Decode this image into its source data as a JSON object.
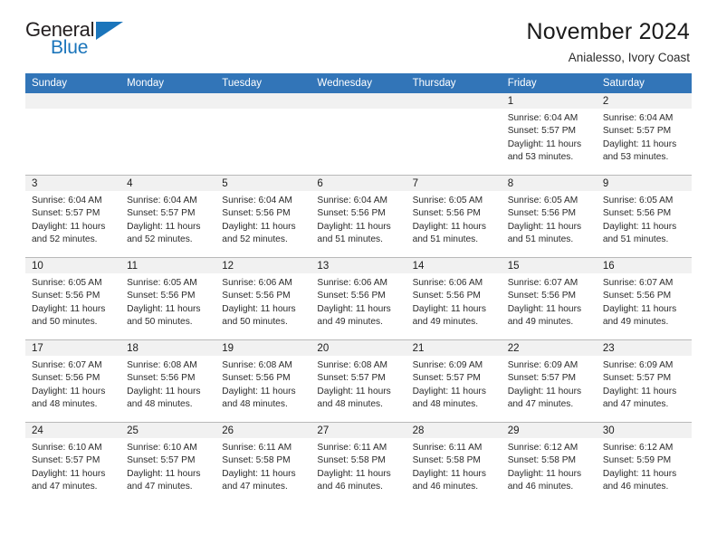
{
  "brand": {
    "name_top": "General",
    "name_bottom": "Blue",
    "accent_color": "#1b75bb",
    "logo_icon": "triangle-icon"
  },
  "header": {
    "title": "November 2024",
    "location": "Anialesso, Ivory Coast"
  },
  "calendar": {
    "header_bg": "#3275b8",
    "daynum_bg": "#f1f1f1",
    "weekday_headers": [
      "Sunday",
      "Monday",
      "Tuesday",
      "Wednesday",
      "Thursday",
      "Friday",
      "Saturday"
    ],
    "weeks": [
      [
        {
          "day": "",
          "empty": true
        },
        {
          "day": "",
          "empty": true
        },
        {
          "day": "",
          "empty": true
        },
        {
          "day": "",
          "empty": true
        },
        {
          "day": "",
          "empty": true
        },
        {
          "day": "1",
          "sunrise": "Sunrise: 6:04 AM",
          "sunset": "Sunset: 5:57 PM",
          "daylight": "Daylight: 11 hours and 53 minutes."
        },
        {
          "day": "2",
          "sunrise": "Sunrise: 6:04 AM",
          "sunset": "Sunset: 5:57 PM",
          "daylight": "Daylight: 11 hours and 53 minutes."
        }
      ],
      [
        {
          "day": "3",
          "sunrise": "Sunrise: 6:04 AM",
          "sunset": "Sunset: 5:57 PM",
          "daylight": "Daylight: 11 hours and 52 minutes."
        },
        {
          "day": "4",
          "sunrise": "Sunrise: 6:04 AM",
          "sunset": "Sunset: 5:57 PM",
          "daylight": "Daylight: 11 hours and 52 minutes."
        },
        {
          "day": "5",
          "sunrise": "Sunrise: 6:04 AM",
          "sunset": "Sunset: 5:56 PM",
          "daylight": "Daylight: 11 hours and 52 minutes."
        },
        {
          "day": "6",
          "sunrise": "Sunrise: 6:04 AM",
          "sunset": "Sunset: 5:56 PM",
          "daylight": "Daylight: 11 hours and 51 minutes."
        },
        {
          "day": "7",
          "sunrise": "Sunrise: 6:05 AM",
          "sunset": "Sunset: 5:56 PM",
          "daylight": "Daylight: 11 hours and 51 minutes."
        },
        {
          "day": "8",
          "sunrise": "Sunrise: 6:05 AM",
          "sunset": "Sunset: 5:56 PM",
          "daylight": "Daylight: 11 hours and 51 minutes."
        },
        {
          "day": "9",
          "sunrise": "Sunrise: 6:05 AM",
          "sunset": "Sunset: 5:56 PM",
          "daylight": "Daylight: 11 hours and 51 minutes."
        }
      ],
      [
        {
          "day": "10",
          "sunrise": "Sunrise: 6:05 AM",
          "sunset": "Sunset: 5:56 PM",
          "daylight": "Daylight: 11 hours and 50 minutes."
        },
        {
          "day": "11",
          "sunrise": "Sunrise: 6:05 AM",
          "sunset": "Sunset: 5:56 PM",
          "daylight": "Daylight: 11 hours and 50 minutes."
        },
        {
          "day": "12",
          "sunrise": "Sunrise: 6:06 AM",
          "sunset": "Sunset: 5:56 PM",
          "daylight": "Daylight: 11 hours and 50 minutes."
        },
        {
          "day": "13",
          "sunrise": "Sunrise: 6:06 AM",
          "sunset": "Sunset: 5:56 PM",
          "daylight": "Daylight: 11 hours and 49 minutes."
        },
        {
          "day": "14",
          "sunrise": "Sunrise: 6:06 AM",
          "sunset": "Sunset: 5:56 PM",
          "daylight": "Daylight: 11 hours and 49 minutes."
        },
        {
          "day": "15",
          "sunrise": "Sunrise: 6:07 AM",
          "sunset": "Sunset: 5:56 PM",
          "daylight": "Daylight: 11 hours and 49 minutes."
        },
        {
          "day": "16",
          "sunrise": "Sunrise: 6:07 AM",
          "sunset": "Sunset: 5:56 PM",
          "daylight": "Daylight: 11 hours and 49 minutes."
        }
      ],
      [
        {
          "day": "17",
          "sunrise": "Sunrise: 6:07 AM",
          "sunset": "Sunset: 5:56 PM",
          "daylight": "Daylight: 11 hours and 48 minutes."
        },
        {
          "day": "18",
          "sunrise": "Sunrise: 6:08 AM",
          "sunset": "Sunset: 5:56 PM",
          "daylight": "Daylight: 11 hours and 48 minutes."
        },
        {
          "day": "19",
          "sunrise": "Sunrise: 6:08 AM",
          "sunset": "Sunset: 5:56 PM",
          "daylight": "Daylight: 11 hours and 48 minutes."
        },
        {
          "day": "20",
          "sunrise": "Sunrise: 6:08 AM",
          "sunset": "Sunset: 5:57 PM",
          "daylight": "Daylight: 11 hours and 48 minutes."
        },
        {
          "day": "21",
          "sunrise": "Sunrise: 6:09 AM",
          "sunset": "Sunset: 5:57 PM",
          "daylight": "Daylight: 11 hours and 48 minutes."
        },
        {
          "day": "22",
          "sunrise": "Sunrise: 6:09 AM",
          "sunset": "Sunset: 5:57 PM",
          "daylight": "Daylight: 11 hours and 47 minutes."
        },
        {
          "day": "23",
          "sunrise": "Sunrise: 6:09 AM",
          "sunset": "Sunset: 5:57 PM",
          "daylight": "Daylight: 11 hours and 47 minutes."
        }
      ],
      [
        {
          "day": "24",
          "sunrise": "Sunrise: 6:10 AM",
          "sunset": "Sunset: 5:57 PM",
          "daylight": "Daylight: 11 hours and 47 minutes."
        },
        {
          "day": "25",
          "sunrise": "Sunrise: 6:10 AM",
          "sunset": "Sunset: 5:57 PM",
          "daylight": "Daylight: 11 hours and 47 minutes."
        },
        {
          "day": "26",
          "sunrise": "Sunrise: 6:11 AM",
          "sunset": "Sunset: 5:58 PM",
          "daylight": "Daylight: 11 hours and 47 minutes."
        },
        {
          "day": "27",
          "sunrise": "Sunrise: 6:11 AM",
          "sunset": "Sunset: 5:58 PM",
          "daylight": "Daylight: 11 hours and 46 minutes."
        },
        {
          "day": "28",
          "sunrise": "Sunrise: 6:11 AM",
          "sunset": "Sunset: 5:58 PM",
          "daylight": "Daylight: 11 hours and 46 minutes."
        },
        {
          "day": "29",
          "sunrise": "Sunrise: 6:12 AM",
          "sunset": "Sunset: 5:58 PM",
          "daylight": "Daylight: 11 hours and 46 minutes."
        },
        {
          "day": "30",
          "sunrise": "Sunrise: 6:12 AM",
          "sunset": "Sunset: 5:59 PM",
          "daylight": "Daylight: 11 hours and 46 minutes."
        }
      ]
    ]
  }
}
